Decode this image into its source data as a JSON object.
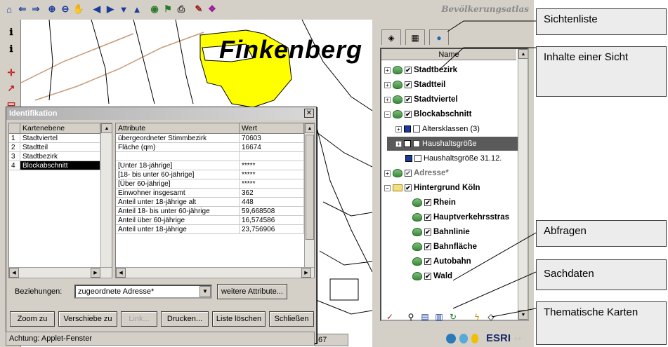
{
  "app": {
    "title": "Bevölkerungsatlas"
  },
  "map": {
    "label": "Finkenberg",
    "colors": {
      "highlight": "#ffff00",
      "road": "#c89878",
      "line": "#000000"
    }
  },
  "toolbar": {
    "icons": [
      "home-icon",
      "back-icon",
      "forward-icon",
      "zoom-in-icon",
      "zoom-out-icon",
      "pan-hand-icon",
      "arrow-left-icon",
      "arrow-right-icon",
      "arrow-down-icon",
      "arrow-up-icon",
      "globe-icon",
      "query-icon",
      "print-icon",
      "edit-icon",
      "book-icon"
    ]
  },
  "layer_panel": {
    "column_header": "Name",
    "items": [
      {
        "label": "Stadtbezirk",
        "checked": true
      },
      {
        "label": "Stadtteil",
        "checked": true
      },
      {
        "label": "Stadtviertel",
        "checked": true
      },
      {
        "label": "Blockabschnitt",
        "checked": true
      },
      {
        "label": "Altersklassen (3)",
        "checked": false
      },
      {
        "label": "Haushaltsgröße",
        "checked": false,
        "selected": true
      },
      {
        "label": "Haushaltsgröße 31.12.",
        "checked": false
      },
      {
        "label": "Adresse*",
        "checked": true
      },
      {
        "label": "Hintergrund Köln",
        "checked": true
      },
      {
        "label": "Rhein",
        "checked": true
      },
      {
        "label": "Hauptverkehrsstras",
        "checked": true
      },
      {
        "label": "Bahnlinie",
        "checked": true
      },
      {
        "label": "Bahnfläche",
        "checked": true
      },
      {
        "label": "Autobahn",
        "checked": true
      },
      {
        "label": "Wald",
        "checked": true
      }
    ]
  },
  "dialog": {
    "title": "Identifikation",
    "layers_header": "Kartenebene",
    "layers": [
      {
        "num": "1",
        "name": "Stadtviertel"
      },
      {
        "num": "2",
        "name": "Stadtteil"
      },
      {
        "num": "3",
        "name": "Stadtbezirk"
      },
      {
        "num": "4",
        "name": "Blockabschnitt",
        "selected": true
      }
    ],
    "attr_header": "Attribute",
    "value_header": "Wert",
    "rows": [
      {
        "attr": "übergeordneter Stimmbezirk",
        "value": "70603"
      },
      {
        "attr": "Fläche (qm)",
        "value": "16674"
      },
      {
        "attr": "",
        "value": ""
      },
      {
        "attr": "[Unter 18-jährige]",
        "value": "*****"
      },
      {
        "attr": "[18- bis unter 60-jährige]",
        "value": "*****"
      },
      {
        "attr": "[Über 60-jährige]",
        "value": "*****"
      },
      {
        "attr": "Einwohner insgesamt",
        "value": "362"
      },
      {
        "attr": "Anteil unter 18-jährige alt",
        "value": "448"
      },
      {
        "attr": "Anteil 18- bis unter 60-jährige",
        "value": "59,668508"
      },
      {
        "attr": "Anteil über 60-jährige",
        "value": "16,574586"
      },
      {
        "attr": "Anteil unter 18-jährige",
        "value": "23,756906"
      }
    ],
    "relations_label": "Beziehungen:",
    "relations_value": "zugeordnete Adresse*",
    "more_attrs_button": "weitere Attribute...",
    "buttons": {
      "zoom": "Zoom zu",
      "pan": "Verschiebe zu",
      "link": "Link...",
      "print": "Drucken...",
      "clear": "Liste löschen",
      "close": "Schließen"
    },
    "status": "Achtung: Applet-Fenster"
  },
  "map_status": {
    "coord_fragment": "67"
  },
  "logo": {
    "text": "ESRI",
    "superscript": "++"
  },
  "annotations": [
    {
      "label": "Sichtenliste"
    },
    {
      "label": "Inhalte einer Sicht"
    },
    {
      "label": "Abfragen"
    },
    {
      "label": "Sachdaten"
    },
    {
      "label": "Thematische Karten"
    }
  ]
}
